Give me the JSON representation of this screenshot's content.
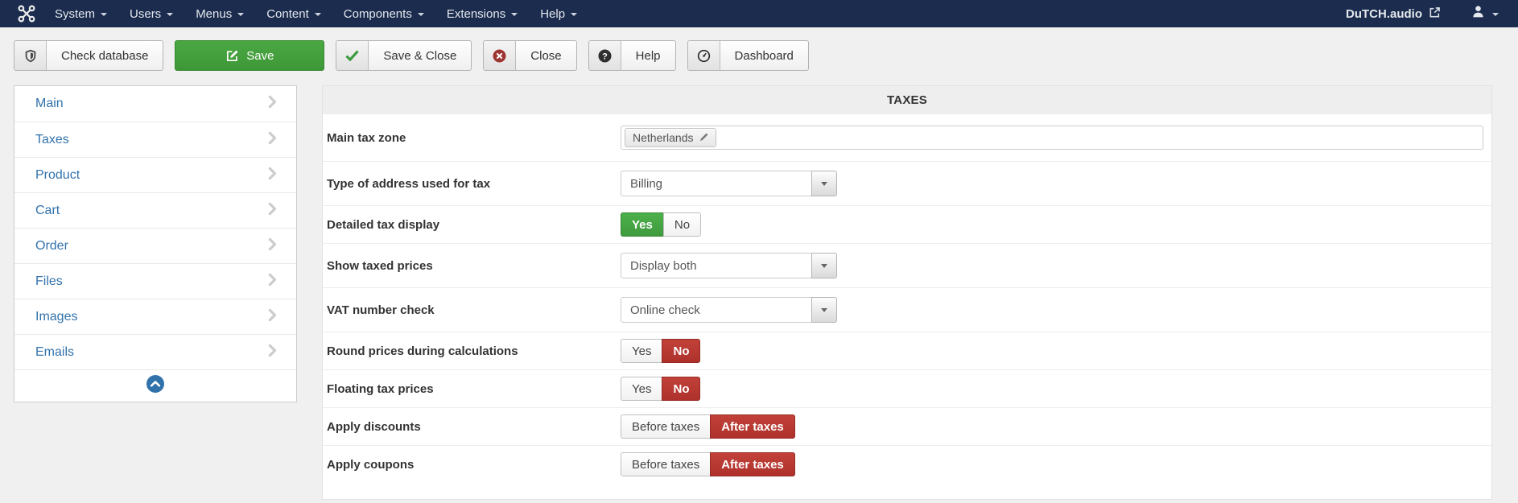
{
  "navbar": {
    "logo_icon": "joomla-logo-icon",
    "menus": [
      {
        "label": "System"
      },
      {
        "label": "Users"
      },
      {
        "label": "Menus"
      },
      {
        "label": "Content"
      },
      {
        "label": "Components"
      },
      {
        "label": "Extensions"
      },
      {
        "label": "Help"
      }
    ],
    "site_link": {
      "label": "DuTCH.audio",
      "icon": "external-link-icon"
    },
    "user_menu": {
      "icon": "user-icon"
    }
  },
  "toolbar": {
    "buttons": [
      {
        "name": "check-database",
        "label": "Check database",
        "icon": "shield-icon",
        "variant": "standard"
      },
      {
        "name": "save",
        "label": "Save",
        "icon": "save-icon",
        "variant": "success"
      },
      {
        "name": "save-close",
        "label": "Save & Close",
        "icon": "check-icon",
        "variant": "standard"
      },
      {
        "name": "close",
        "label": "Close",
        "icon": "cancel-icon",
        "variant": "standard"
      },
      {
        "name": "help",
        "label": "Help",
        "icon": "question-icon",
        "variant": "standard"
      },
      {
        "name": "dashboard",
        "label": "Dashboard",
        "icon": "dashboard-icon",
        "variant": "standard"
      }
    ]
  },
  "sidebar": {
    "items": [
      {
        "label": "Main"
      },
      {
        "label": "Taxes"
      },
      {
        "label": "Product"
      },
      {
        "label": "Cart"
      },
      {
        "label": "Order"
      },
      {
        "label": "Files"
      },
      {
        "label": "Images"
      },
      {
        "label": "Emails"
      }
    ],
    "collapse_icon": "circle-up-icon"
  },
  "main": {
    "section_title": "TAXES",
    "rows": [
      {
        "type": "tags",
        "label": "Main tax zone",
        "tags": [
          {
            "text": "Netherlands",
            "icon": "pencil-icon"
          }
        ]
      },
      {
        "type": "select",
        "label": "Type of address used for tax",
        "value": "Billing"
      },
      {
        "type": "toggle",
        "label": "Detailed tax display",
        "options": [
          {
            "text": "Yes",
            "state": "success"
          },
          {
            "text": "No",
            "state": "off"
          }
        ]
      },
      {
        "type": "select",
        "label": "Show taxed prices",
        "value": "Display both"
      },
      {
        "type": "select",
        "label": "VAT number check",
        "value": "Online check"
      },
      {
        "type": "toggle",
        "label": "Round prices during calculations",
        "options": [
          {
            "text": "Yes",
            "state": "off"
          },
          {
            "text": "No",
            "state": "danger"
          }
        ]
      },
      {
        "type": "toggle",
        "label": "Floating tax prices",
        "options": [
          {
            "text": "Yes",
            "state": "off"
          },
          {
            "text": "No",
            "state": "danger"
          }
        ]
      },
      {
        "type": "toggle",
        "label": "Apply discounts",
        "options": [
          {
            "text": "Before taxes",
            "state": "off"
          },
          {
            "text": "After taxes",
            "state": "danger"
          }
        ]
      },
      {
        "type": "toggle",
        "label": "Apply coupons",
        "options": [
          {
            "text": "Before taxes",
            "state": "off"
          },
          {
            "text": "After taxes",
            "state": "danger"
          }
        ]
      }
    ]
  },
  "colors": {
    "navbar_bg": "#1b2c4e",
    "link_blue": "#3272ab",
    "success_green": "#46a546",
    "danger_red": "#bd362f",
    "page_bg": "#f0f0f0",
    "panel_head_bg": "#eeeeee"
  }
}
